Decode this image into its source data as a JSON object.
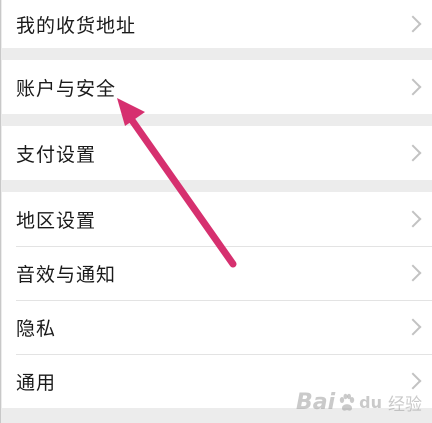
{
  "settings": {
    "items": [
      {
        "label": "我的收货地址"
      },
      {
        "label": "账户与安全"
      },
      {
        "label": "支付设置"
      },
      {
        "label": "地区设置"
      },
      {
        "label": "音效与通知"
      },
      {
        "label": "隐私"
      },
      {
        "label": "通用"
      }
    ]
  },
  "annotation": {
    "arrow_color": "#d6306f"
  },
  "watermark": {
    "brand_left": "Bai",
    "brand_right": "du",
    "suffix": "经验"
  },
  "colors": {
    "background": "#ececec",
    "row_background": "#ffffff",
    "text": "#1a1a1a",
    "chevron": "#c2c2c2"
  }
}
